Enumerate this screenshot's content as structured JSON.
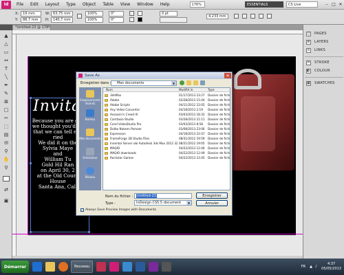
{
  "app": {
    "logo": "Id",
    "menu": [
      "File",
      "Edit",
      "Layout",
      "Type",
      "Object",
      "Table",
      "View",
      "Window",
      "Help"
    ],
    "zoom": "176%",
    "workspace": "ESSENTIALS",
    "search_placeholder": "CS Live"
  },
  "control_panel": {
    "x_label": "X:",
    "x_value": "19 mm",
    "y_label": "Y:",
    "y_value": "88,7 mm",
    "w_label": "W:",
    "w_value": "63,75 mm",
    "h_label": "H:",
    "h_value": "140,7 mm",
    "scale_x": "100%",
    "scale_y": "100%",
    "angle": "0°",
    "shear": "0°",
    "stroke_weight": "0 pt",
    "stroke_size": "4,233 mm"
  },
  "document_tab": "*Untitled-23 @ 178%",
  "right_panels": [
    {
      "label": "PAGES",
      "icon": "pages-icon"
    },
    {
      "label": "LAYERS",
      "icon": "layers-icon"
    },
    {
      "label": "LINKS",
      "icon": "links-icon"
    },
    {
      "label": "STROKE",
      "icon": "stroke-icon"
    },
    {
      "label": "COLOUR",
      "icon": "colour-icon"
    },
    {
      "label": "SWATCHES",
      "icon": "swatches-icon"
    }
  ],
  "canvas": {
    "title_text": "Invita",
    "body_lines": [
      "Because you are gre",
      "we thought you'd lik",
      "that we can tell eve",
      "ried",
      "We did it on the",
      "Sylvia Maye",
      "and",
      "William Tu",
      "Gold Hil Ran",
      "on April 30, 2",
      "at the Old Count",
      "House",
      "Santa Ana, Cali"
    ]
  },
  "save_dialog": {
    "title": "Save As",
    "save_in_label": "Enregistrer dans :",
    "save_in_value": "Mes documents",
    "places": [
      "Emplacements récents",
      "Bureau",
      "Mes documents",
      "Ordinateur",
      "Réseau"
    ],
    "columns": {
      "name": "Nom",
      "modified": "Modifié le",
      "type": "Type"
    },
    "files": [
      {
        "name": "3dsMax",
        "date": "01/17/2013 23:27",
        "type": "Dossier de fichi"
      },
      {
        "name": "Adobe",
        "date": "02/28/2013 15:44",
        "type": "Dossier de fichi"
      },
      {
        "name": "Adobe Scripts",
        "date": "04/11/2012 22:05",
        "type": "Dossier de fichi"
      },
      {
        "name": "Any Video Converter",
        "date": "04/18/2013 2:19",
        "type": "Dossier de fichi"
      },
      {
        "name": "Assassin's Creed III",
        "date": "03/03/2013 18:32",
        "type": "Dossier de fichi"
      },
      {
        "name": "Camtasia Studio",
        "date": "03/28/2013 21:11",
        "type": "Dossier de fichi"
      },
      {
        "name": "Corel VideoStudio Pro",
        "date": "03/03/2013 8:58",
        "type": "Dossier de fichi"
      },
      {
        "name": "Dolbo Nuteen Pomoer",
        "date": "03/08/2013 23:06",
        "type": "Dossier de fichi"
      },
      {
        "name": "Expression",
        "date": "04/18/2013 22:47",
        "type": "Dossier de fichi"
      },
      {
        "name": "FrameForge 3D Studio Files",
        "date": "08/31/2012 19:59",
        "type": "Dossier de fichi"
      },
      {
        "name": "Inventor Server obi Autodesk 3ds Max 2012 32...",
        "date": "08/21/2012 19:05",
        "type": "Dossier de fichi"
      },
      {
        "name": "MAQIO",
        "date": "04/22/2013 12:46",
        "type": "Dossier de fichi"
      },
      {
        "name": "MAQIO downloads",
        "date": "04/22/2013 12:49",
        "type": "Dossier de fichi"
      },
      {
        "name": "Rockstar Games",
        "date": "04/22/2013 23:45",
        "type": "Dossier de fichi"
      }
    ],
    "filename_label": "Nom du fichier :",
    "filename_value": "Untitled-23",
    "type_label": "Type :",
    "type_value": "InDesign CS5.5 document",
    "save_button": "Enregistrer",
    "cancel_button": "Annuler",
    "checkbox_label": "Always Save Preview Images with Documents",
    "checkbox_checked": true
  },
  "taskbar": {
    "start": "Démarrer",
    "task": "Nouveau",
    "tray_lang": "FR",
    "time": "4:37",
    "date": "05/05/2013"
  }
}
